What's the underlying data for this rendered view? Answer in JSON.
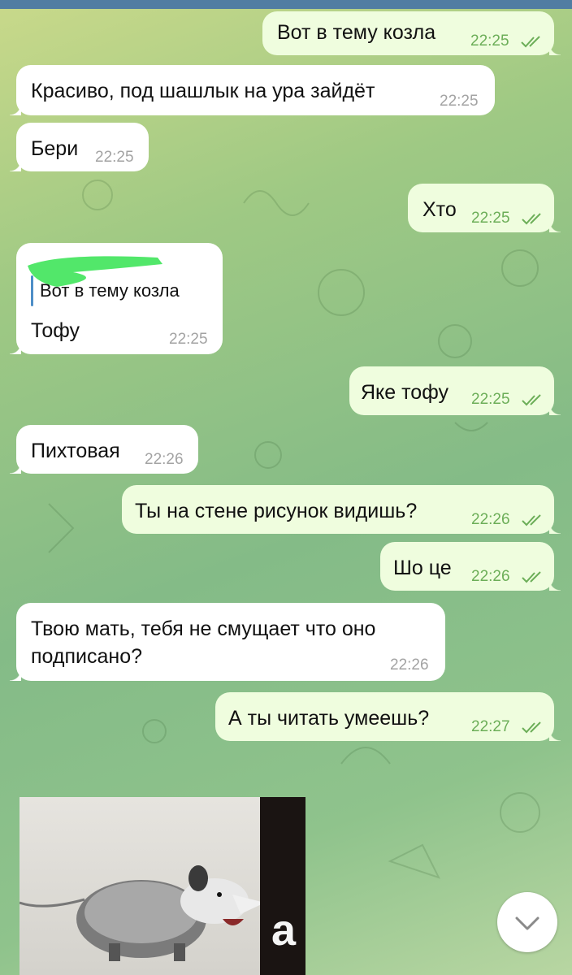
{
  "colors": {
    "outgoing_bubble": "#effdde",
    "incoming_bubble": "#ffffff",
    "outgoing_time": "#6cae58",
    "incoming_time": "#a3a3a3",
    "reply_accent": "#4e8ec7"
  },
  "messages": [
    {
      "dir": "out",
      "text": "Вот в тему козла",
      "time": "22:25",
      "read": true
    },
    {
      "dir": "in",
      "text": "Красиво, под шашлык на ура зайдёт",
      "time": "22:25"
    },
    {
      "dir": "in",
      "text": "Бери",
      "time": "22:25"
    },
    {
      "dir": "out",
      "text": "Хто",
      "time": "22:25",
      "read": true
    },
    {
      "dir": "in",
      "reply_to": "Вот в тему козла",
      "text": "Тофу",
      "time": "22:25"
    },
    {
      "dir": "out",
      "text": "Яке тофу",
      "time": "22:25",
      "read": true
    },
    {
      "dir": "in",
      "text": "Пихтовая",
      "time": "22:26"
    },
    {
      "dir": "out",
      "text": "Ты на стене рисунок видишь?",
      "time": "22:26",
      "read": true
    },
    {
      "dir": "out",
      "text": "Шо це",
      "time": "22:26",
      "read": true
    },
    {
      "dir": "in",
      "text_line1": "Твою мать, тебя не смущает что оно",
      "text_line2": "подписано?",
      "time": "22:26"
    },
    {
      "dir": "out",
      "text": "А ты читать умеешь?",
      "time": "22:27",
      "read": true
    }
  ],
  "photo": {
    "caption_letter": "а",
    "icon": "possum-photo"
  },
  "scroll_button": {
    "icon": "chevron-down-icon"
  }
}
